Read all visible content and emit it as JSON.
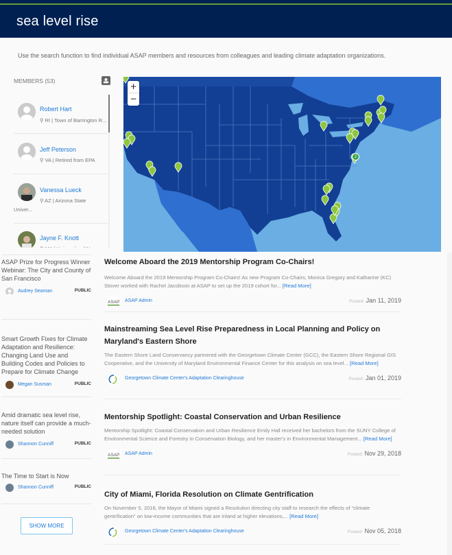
{
  "header": {
    "title": "sea level rise",
    "accent_stripe": "#5e9e3a",
    "background": "#002052"
  },
  "intro": "Use the search function to find individual ASAP members and resources from colleagues and leading climate adaptation organizations.",
  "members": {
    "heading": "MEMBERS (53)",
    "toggle_icon": "person-icon",
    "items": [
      {
        "name": "Robert Hart",
        "location": "RI | Town of Barrington R...",
        "location_cont": "",
        "avatar": "placeholder"
      },
      {
        "name": "Jeff Peterson",
        "location": "VA | Retired from EPA",
        "location_cont": "",
        "avatar": "placeholder"
      },
      {
        "name": "Vanessa Lueck",
        "location": "AZ | Arizona State",
        "location_cont": "Univer...",
        "avatar": "photo"
      },
      {
        "name": "Jayne F. Knott",
        "location": "MA | University of N...",
        "location_cont": "",
        "avatar": "photo"
      }
    ]
  },
  "map": {
    "zoom_in": "+",
    "zoom_out": "−",
    "cluster_label": "2",
    "marker_color": "#8dc63f"
  },
  "resources": [
    {
      "title": "ASAP Prize for Progress Winner Webinar: The City and County of San Francisco",
      "author": "Audrey Seaman",
      "visibility": "PUBLIC"
    },
    {
      "title": "Smart Growth Fixes for Climate Adaptation and Resilience: Changing Land Use and Building Codes and Policies to Prepare for Climate Change",
      "author": "Megan Susman",
      "visibility": "PUBLIC"
    },
    {
      "title": "Amid dramatic sea level rise, nature itself can provide a much-needed solution",
      "author": "Shannon Cunniff",
      "visibility": "PUBLIC"
    },
    {
      "title": "The Time to Start is Now",
      "author": "Shannon Cunniff",
      "visibility": "PUBLIC"
    }
  ],
  "show_more": "SHOW MORE",
  "articles": [
    {
      "title": "Welcome Aboard the 2019 Mentorship Program Co-Chairs!",
      "excerpt": "Welcome Aboard the 2019 Mentorship Program Co-Chairs! As new Program Co-Chairs, Monica Gregory and Katharine (KC) Stover worked with Rachel Jacobson at ASAP to set up the 2019 cohort for...",
      "read_more": "[Read More]",
      "source": "ASAP Admin",
      "source_logo": "ASAP",
      "posted_label": "Posted:",
      "date": "Jan 11, 2019"
    },
    {
      "title": "Mainstreaming Sea Level Rise Preparedness in Local Planning and Policy on Maryland's Eastern Shore",
      "excerpt": "The Eastern Shore Land Conservancy partnered with the Georgetown Climate Center (GCC), the Eastern Shore Regional GIS Cooperative, and the University of Maryland Environmental Finance Center for this analysis on sea level...",
      "read_more": "[Read More]",
      "source": "Georgetown Climate Center's Adaptation Clearinghouse",
      "source_logo": "GCC",
      "posted_label": "Posted:",
      "date": "Jan 01, 2019"
    },
    {
      "title": "Mentorship Spotlight: Coastal Conservation and Urban Resilience",
      "excerpt": "Mentorship Spotlight: Coastal Conservation and Urban Resilience Emily Hall received her bachelors from the SUNY College of Environmental Science and Forestry in Conservation Biology, and her master's in Environmental Management...",
      "read_more": "[Read More]",
      "source": "ASAP Admin",
      "source_logo": "ASAP",
      "posted_label": "Posted:",
      "date": "Nov 29, 2018"
    },
    {
      "title": "City of Miami, Florida Resolution on Climate Gentrification",
      "excerpt": "On November 5, 2018, the Mayor of Miami signed a Resolution directing city staff to research the effects of “climate gentrification” on low-income communities that are inland at higher elevations,...",
      "read_more": "[Read More]",
      "source": "Georgetown Climate Center's Adaptation Clearinghouse",
      "source_logo": "GCC",
      "posted_label": "Posted:",
      "date": "Nov 05, 2018"
    }
  ]
}
